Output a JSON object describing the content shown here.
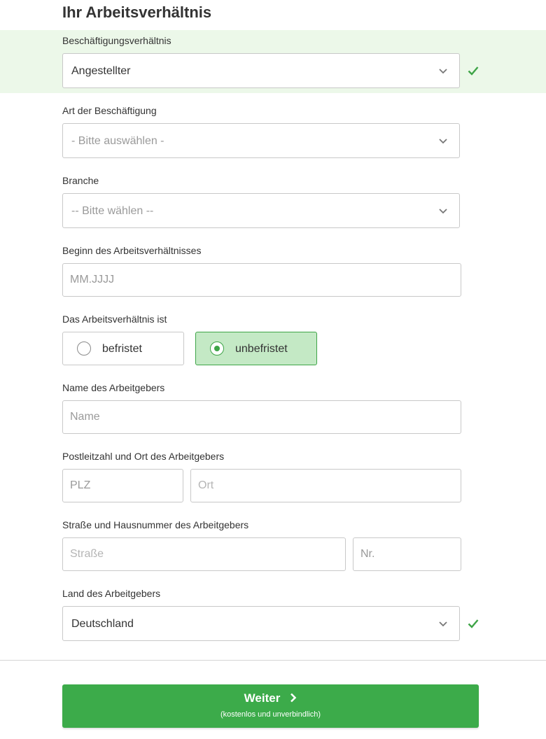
{
  "section": {
    "title": "Ihr Arbeitsverhältnis"
  },
  "employment_status": {
    "label": "Beschäftigungsverhältnis",
    "value": "Angestellter",
    "valid": true
  },
  "employment_type": {
    "label": "Art der Beschäftigung",
    "placeholder": "- Bitte auswählen -"
  },
  "industry": {
    "label": "Branche",
    "placeholder": "-- Bitte wählen --"
  },
  "start_date": {
    "label": "Beginn des Arbeitsverhältnisses",
    "placeholder": "MM.JJJJ"
  },
  "contract": {
    "label": "Das Arbeitsverhältnis ist",
    "options": [
      {
        "label": "befristet",
        "selected": false
      },
      {
        "label": "unbefristet",
        "selected": true
      }
    ]
  },
  "employer_name": {
    "label": "Name des Arbeitgebers",
    "placeholder": "Name"
  },
  "employer_city": {
    "label": "Postleitzahl und Ort des Arbeitgebers",
    "zip_placeholder": "PLZ",
    "city_placeholder": "Ort"
  },
  "employer_street": {
    "label": "Straße und Hausnummer des Arbeitgebers",
    "street_placeholder": "Straße",
    "number_placeholder": "Nr."
  },
  "employer_country": {
    "label": "Land des Arbeitgebers",
    "value": "Deutschland",
    "valid": true
  },
  "next_button": {
    "label": "Weiter",
    "sublabel": "(kostenlos und unverbindlich)"
  },
  "colors": {
    "accent": "#3cab4a",
    "valid_band": "#ecf8e9",
    "selected_option": "#c4e9c5",
    "check": "#3ea447"
  },
  "icons": {
    "dropdown": "chevron-down-icon",
    "valid": "checkmark-icon",
    "next": "chevron-right-icon"
  }
}
